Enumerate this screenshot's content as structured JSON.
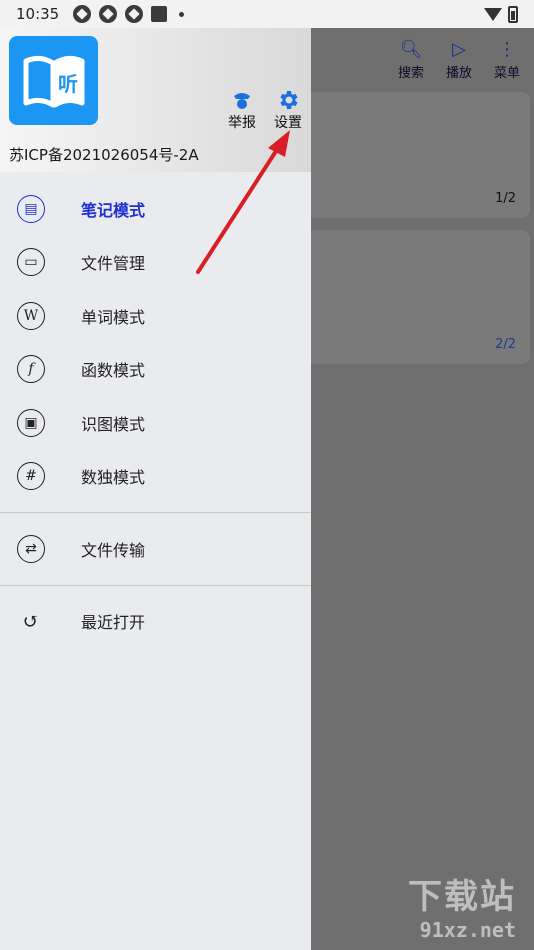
{
  "status_bar": {
    "time": "10:35"
  },
  "background_app": {
    "toolbar": [
      {
        "label": "搜索",
        "icon": "search-doc-icon"
      },
      {
        "label": "播放",
        "icon": "play-icon"
      },
      {
        "label": "菜单",
        "icon": "more-vert-icon"
      }
    ],
    "cards": [
      {
        "page": "1/2"
      },
      {
        "page": "2/2"
      }
    ]
  },
  "drawer": {
    "logo_text": "听",
    "header_actions": [
      {
        "label": "举报",
        "icon": "police-icon"
      },
      {
        "label": "设置",
        "icon": "gear-icon"
      }
    ],
    "icp": "苏ICP备2021026054号-2A",
    "menu": [
      {
        "label": "笔记模式",
        "icon": "note-icon",
        "active": true
      },
      {
        "label": "文件管理",
        "icon": "folder-icon"
      },
      {
        "label": "单词模式",
        "icon": "w-icon"
      },
      {
        "label": "函数模式",
        "icon": "function-icon"
      },
      {
        "label": "识图模式",
        "icon": "image-search-icon"
      },
      {
        "label": "数独模式",
        "icon": "grid-hash-icon"
      }
    ],
    "menu2": [
      {
        "label": "文件传输",
        "icon": "transfer-icon"
      }
    ],
    "menu3": [
      {
        "label": "最近打开",
        "icon": "history-icon"
      }
    ]
  },
  "colors": {
    "accent": "#1f2fd2",
    "logo": "#1b97f3",
    "annotation": "#d81f26"
  },
  "watermark": {
    "line1": "下载站",
    "line2": "91xz.net"
  }
}
